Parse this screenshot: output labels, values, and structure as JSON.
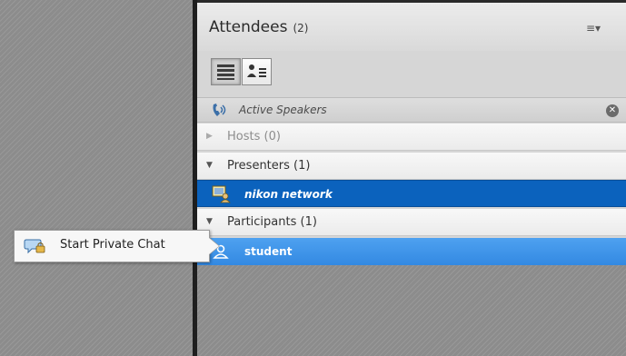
{
  "panel": {
    "title": "Attendees",
    "count": "(2)",
    "menu_icon": "≡▾"
  },
  "view_toggle": {
    "list_icon": "list-view-icon",
    "grid_icon": "attendee-grid-icon"
  },
  "active_speakers": {
    "label": "Active Speakers",
    "close_glyph": "✕"
  },
  "groups": {
    "hosts": {
      "label": "Hosts (0)",
      "expanded": false
    },
    "presenters": {
      "label": "Presenters (1)",
      "expanded": true
    },
    "participants": {
      "label": "Participants (1)",
      "expanded": true
    }
  },
  "attendees": {
    "presenter": {
      "name": "nikon network"
    },
    "participant": {
      "name": "student"
    }
  },
  "context_menu": {
    "item_label": "Start Private Chat"
  },
  "colors": {
    "selected_row": "#0b62bd",
    "hover_row": "#3d93e8",
    "header_bg": "#e3e3e3"
  }
}
